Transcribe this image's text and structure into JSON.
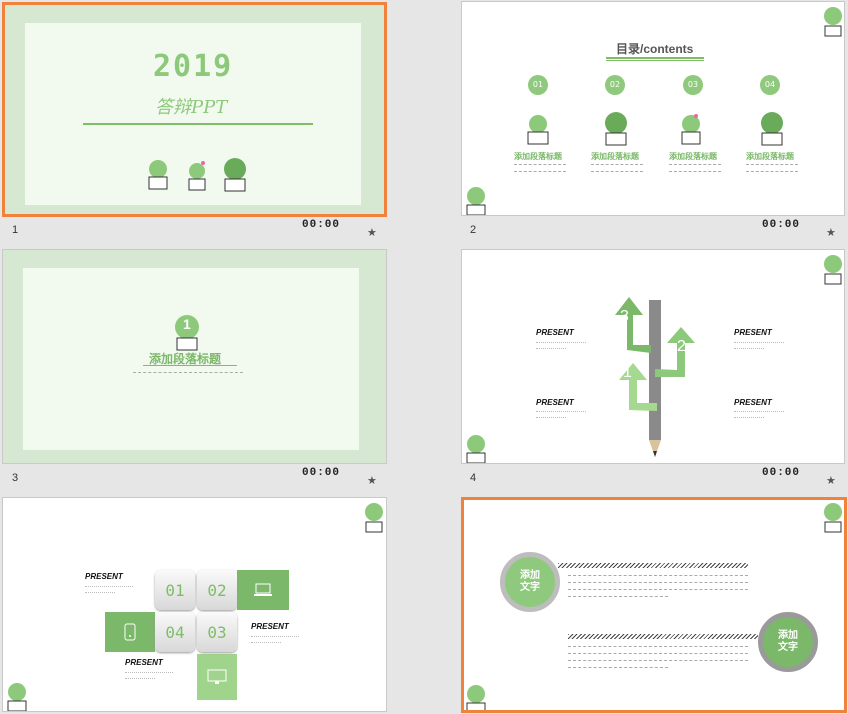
{
  "slides": [
    {
      "number": "1",
      "time": "00:00",
      "title": "2019",
      "subtitle": "答辩PPT"
    },
    {
      "number": "2",
      "time": "00:00",
      "title": "目录/contents",
      "items": [
        {
          "n": "01",
          "label": "添加段落标题"
        },
        {
          "n": "02",
          "label": "添加段落标题"
        },
        {
          "n": "03",
          "label": "添加段落标题"
        },
        {
          "n": "04",
          "label": "添加段落标题"
        }
      ]
    },
    {
      "number": "3",
      "time": "00:00",
      "badge": "1",
      "title": "添加段落标题"
    },
    {
      "number": "4",
      "time": "00:00",
      "heads": [
        "PRESENT",
        "PRESENT",
        "PRESENT",
        "PRESENT"
      ],
      "arrows": [
        "3",
        "2",
        "1"
      ]
    },
    {
      "number": "",
      "time": "",
      "heads": [
        "PRESENT",
        "PRESENT",
        "PRESENT"
      ],
      "tiles": [
        "01",
        "02",
        "04",
        "03"
      ]
    },
    {
      "number": "",
      "time": "",
      "circles": [
        "添加\n文字",
        "添加\n文字"
      ]
    }
  ],
  "icons": {
    "slide_action": "star-icon"
  },
  "colors": {
    "accent": "#f0823c",
    "green": "#7cb86a",
    "light_green": "#f2faf0"
  }
}
